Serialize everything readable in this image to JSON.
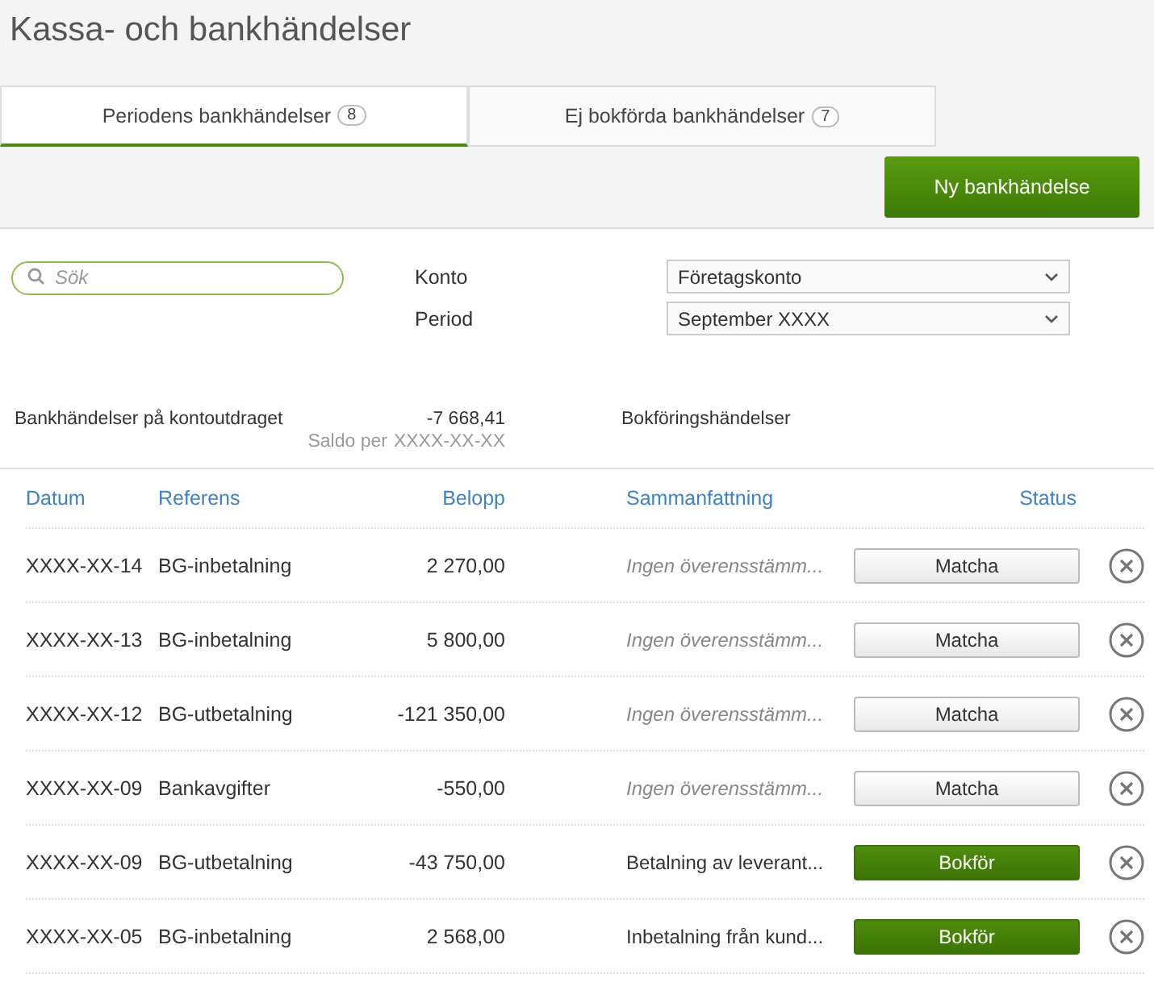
{
  "title": "Kassa- och bankhändelser",
  "tabs": [
    {
      "label": "Periodens bankhändelser",
      "count": "8",
      "selected": true
    },
    {
      "label": "Ej bokförda bankhändelser",
      "count": "7",
      "selected": false
    }
  ],
  "new_button": "Ny bankhändelse",
  "search": {
    "placeholder": "Sök"
  },
  "filters": [
    {
      "label": "Konto",
      "value": "Företagskonto"
    },
    {
      "label": "Period",
      "value": "September  XXXX"
    }
  ],
  "summary": {
    "bank_heading": "Bankhändelser på kontoutdraget",
    "balance": "-7 668,41",
    "balance_label": "Saldo per",
    "balance_date": "XXXX-XX-XX",
    "book_heading": "Bokföringshändelser"
  },
  "table": {
    "columns": [
      "Datum",
      "Referens",
      "Belopp",
      "Sammanfattning",
      "Status"
    ],
    "rows": [
      {
        "date": "XXXX-XX-14",
        "reference": "BG-inbetalning",
        "amount": "2 270,00",
        "summary": "Ingen överensstämm...",
        "kind": "unmatched",
        "action": "Matcha"
      },
      {
        "date": "XXXX-XX-13",
        "reference": "BG-inbetalning",
        "amount": "5 800,00",
        "summary": "Ingen överensstämm...",
        "kind": "unmatched",
        "action": "Matcha"
      },
      {
        "date": "XXXX-XX-12",
        "reference": "BG-utbetalning",
        "amount": "-121 350,00",
        "summary": "Ingen överensstämm...",
        "kind": "unmatched",
        "action": "Matcha"
      },
      {
        "date": "XXXX-XX-09",
        "reference": "Bankavgifter",
        "amount": "-550,00",
        "summary": "Ingen överensstämm...",
        "kind": "unmatched",
        "action": "Matcha"
      },
      {
        "date": "XXXX-XX-09",
        "reference": "BG-utbetalning",
        "amount": "-43 750,00",
        "summary": "Betalning av leverant...",
        "kind": "matched",
        "action": "Bokför"
      },
      {
        "date": "XXXX-XX-05",
        "reference": "BG-inbetalning",
        "amount": "2 568,00",
        "summary": "Inbetalning från kund...",
        "kind": "matched",
        "action": "Bokför"
      }
    ]
  }
}
